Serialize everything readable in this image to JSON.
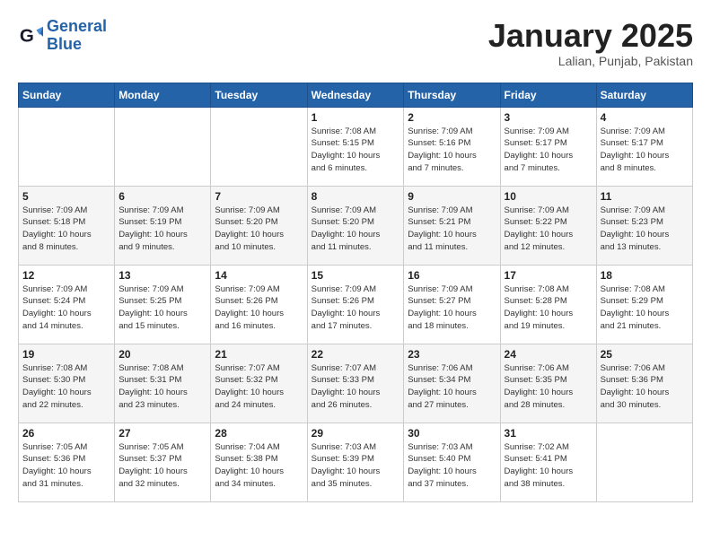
{
  "header": {
    "logo_line1": "General",
    "logo_line2": "Blue",
    "title": "January 2025",
    "subtitle": "Lalian, Punjab, Pakistan"
  },
  "days_of_week": [
    "Sunday",
    "Monday",
    "Tuesday",
    "Wednesday",
    "Thursday",
    "Friday",
    "Saturday"
  ],
  "weeks": [
    [
      {
        "day": "",
        "info": ""
      },
      {
        "day": "",
        "info": ""
      },
      {
        "day": "",
        "info": ""
      },
      {
        "day": "1",
        "info": "Sunrise: 7:08 AM\nSunset: 5:15 PM\nDaylight: 10 hours\nand 6 minutes."
      },
      {
        "day": "2",
        "info": "Sunrise: 7:09 AM\nSunset: 5:16 PM\nDaylight: 10 hours\nand 7 minutes."
      },
      {
        "day": "3",
        "info": "Sunrise: 7:09 AM\nSunset: 5:17 PM\nDaylight: 10 hours\nand 7 minutes."
      },
      {
        "day": "4",
        "info": "Sunrise: 7:09 AM\nSunset: 5:17 PM\nDaylight: 10 hours\nand 8 minutes."
      }
    ],
    [
      {
        "day": "5",
        "info": "Sunrise: 7:09 AM\nSunset: 5:18 PM\nDaylight: 10 hours\nand 8 minutes."
      },
      {
        "day": "6",
        "info": "Sunrise: 7:09 AM\nSunset: 5:19 PM\nDaylight: 10 hours\nand 9 minutes."
      },
      {
        "day": "7",
        "info": "Sunrise: 7:09 AM\nSunset: 5:20 PM\nDaylight: 10 hours\nand 10 minutes."
      },
      {
        "day": "8",
        "info": "Sunrise: 7:09 AM\nSunset: 5:20 PM\nDaylight: 10 hours\nand 11 minutes."
      },
      {
        "day": "9",
        "info": "Sunrise: 7:09 AM\nSunset: 5:21 PM\nDaylight: 10 hours\nand 11 minutes."
      },
      {
        "day": "10",
        "info": "Sunrise: 7:09 AM\nSunset: 5:22 PM\nDaylight: 10 hours\nand 12 minutes."
      },
      {
        "day": "11",
        "info": "Sunrise: 7:09 AM\nSunset: 5:23 PM\nDaylight: 10 hours\nand 13 minutes."
      }
    ],
    [
      {
        "day": "12",
        "info": "Sunrise: 7:09 AM\nSunset: 5:24 PM\nDaylight: 10 hours\nand 14 minutes."
      },
      {
        "day": "13",
        "info": "Sunrise: 7:09 AM\nSunset: 5:25 PM\nDaylight: 10 hours\nand 15 minutes."
      },
      {
        "day": "14",
        "info": "Sunrise: 7:09 AM\nSunset: 5:26 PM\nDaylight: 10 hours\nand 16 minutes."
      },
      {
        "day": "15",
        "info": "Sunrise: 7:09 AM\nSunset: 5:26 PM\nDaylight: 10 hours\nand 17 minutes."
      },
      {
        "day": "16",
        "info": "Sunrise: 7:09 AM\nSunset: 5:27 PM\nDaylight: 10 hours\nand 18 minutes."
      },
      {
        "day": "17",
        "info": "Sunrise: 7:08 AM\nSunset: 5:28 PM\nDaylight: 10 hours\nand 19 minutes."
      },
      {
        "day": "18",
        "info": "Sunrise: 7:08 AM\nSunset: 5:29 PM\nDaylight: 10 hours\nand 21 minutes."
      }
    ],
    [
      {
        "day": "19",
        "info": "Sunrise: 7:08 AM\nSunset: 5:30 PM\nDaylight: 10 hours\nand 22 minutes."
      },
      {
        "day": "20",
        "info": "Sunrise: 7:08 AM\nSunset: 5:31 PM\nDaylight: 10 hours\nand 23 minutes."
      },
      {
        "day": "21",
        "info": "Sunrise: 7:07 AM\nSunset: 5:32 PM\nDaylight: 10 hours\nand 24 minutes."
      },
      {
        "day": "22",
        "info": "Sunrise: 7:07 AM\nSunset: 5:33 PM\nDaylight: 10 hours\nand 26 minutes."
      },
      {
        "day": "23",
        "info": "Sunrise: 7:06 AM\nSunset: 5:34 PM\nDaylight: 10 hours\nand 27 minutes."
      },
      {
        "day": "24",
        "info": "Sunrise: 7:06 AM\nSunset: 5:35 PM\nDaylight: 10 hours\nand 28 minutes."
      },
      {
        "day": "25",
        "info": "Sunrise: 7:06 AM\nSunset: 5:36 PM\nDaylight: 10 hours\nand 30 minutes."
      }
    ],
    [
      {
        "day": "26",
        "info": "Sunrise: 7:05 AM\nSunset: 5:36 PM\nDaylight: 10 hours\nand 31 minutes."
      },
      {
        "day": "27",
        "info": "Sunrise: 7:05 AM\nSunset: 5:37 PM\nDaylight: 10 hours\nand 32 minutes."
      },
      {
        "day": "28",
        "info": "Sunrise: 7:04 AM\nSunset: 5:38 PM\nDaylight: 10 hours\nand 34 minutes."
      },
      {
        "day": "29",
        "info": "Sunrise: 7:03 AM\nSunset: 5:39 PM\nDaylight: 10 hours\nand 35 minutes."
      },
      {
        "day": "30",
        "info": "Sunrise: 7:03 AM\nSunset: 5:40 PM\nDaylight: 10 hours\nand 37 minutes."
      },
      {
        "day": "31",
        "info": "Sunrise: 7:02 AM\nSunset: 5:41 PM\nDaylight: 10 hours\nand 38 minutes."
      },
      {
        "day": "",
        "info": ""
      }
    ]
  ]
}
